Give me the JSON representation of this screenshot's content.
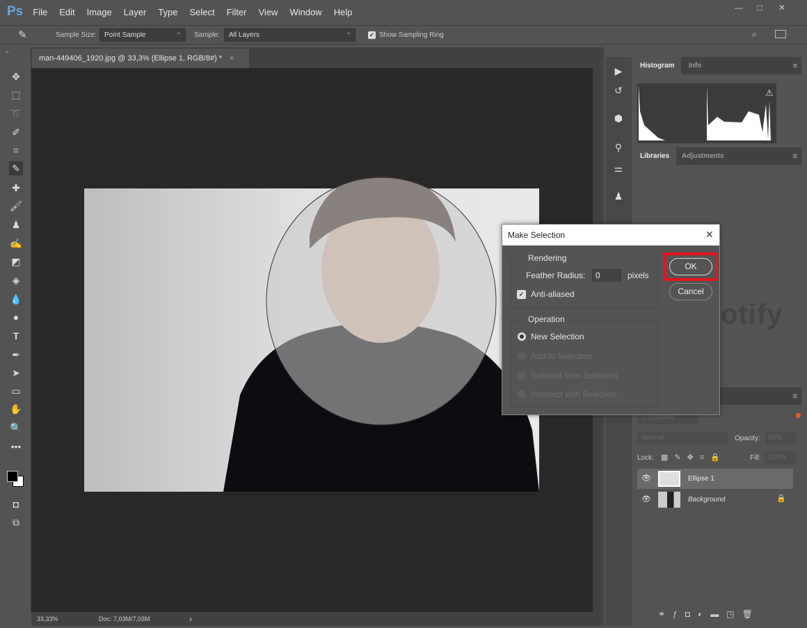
{
  "app": {
    "logo": "Ps",
    "menu": [
      "File",
      "Edit",
      "Image",
      "Layer",
      "Type",
      "Select",
      "Filter",
      "View",
      "Window",
      "Help"
    ]
  },
  "options": {
    "sample_size_label": "Sample Size:",
    "sample_size_value": "Point Sample",
    "sample_label": "Sample:",
    "sample_value": "All Layers",
    "show_ring_label": "Show Sampling Ring",
    "show_ring_checked": true
  },
  "document": {
    "tab_title": "man-449406_1920.jpg @ 33,3% (Ellipse 1, RGB/8#) *",
    "close": "×"
  },
  "status": {
    "zoom": "33,33%",
    "doc": "Doc: 7,03M/7,03M",
    "arrow": "›"
  },
  "panels": {
    "histogram_tab": "Histogram",
    "info_tab": "Info",
    "libraries_tab": "Libraries",
    "adjustments_tab": "Adjustments"
  },
  "layers": {
    "search_placeholder": "Selected",
    "blend_mode": "Normal",
    "opacity_label": "Opacity:",
    "opacity_value": "50%",
    "lock_label": "Lock:",
    "fill_label": "Fill:",
    "fill_value": "100%",
    "items": [
      {
        "name": "Ellipse 1",
        "selected": true
      },
      {
        "name": "Background",
        "locked": true
      }
    ]
  },
  "dialog": {
    "title": "Make Selection",
    "close": "×",
    "rendering": "Rendering",
    "feather_label": "Feather Radius:",
    "feather_value": "0",
    "feather_unit": "pixels",
    "anti_aliased": "Anti-aliased",
    "anti_aliased_checked": true,
    "operation": "Operation",
    "options": [
      {
        "label": "New Selection",
        "selected": true,
        "enabled": true
      },
      {
        "label": "Add to Selection",
        "enabled": false
      },
      {
        "label": "Subtract from Selection",
        "enabled": false
      },
      {
        "label": "Intersect with Selection",
        "enabled": false
      }
    ],
    "ok": "OK",
    "cancel": "Cancel",
    "highlight_color": "#e8141c"
  },
  "watermark": "uplotify"
}
